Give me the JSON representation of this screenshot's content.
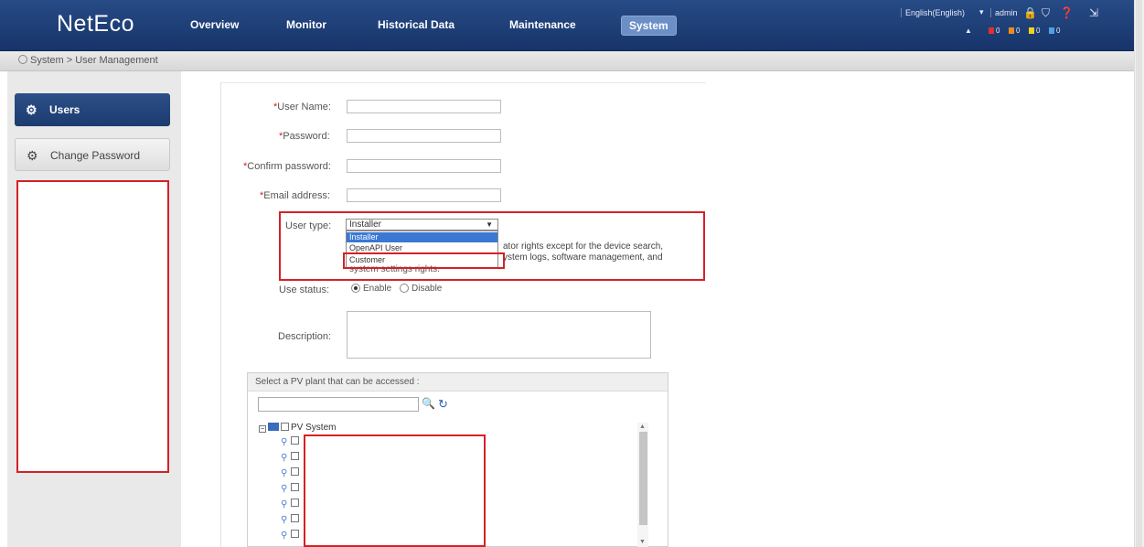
{
  "header": {
    "logo": "NetEco",
    "nav": [
      {
        "label": "Overview"
      },
      {
        "label": "Monitor"
      },
      {
        "label": "Historical Data"
      },
      {
        "label": "Maintenance"
      },
      {
        "label": "System"
      }
    ],
    "language": "English(English)",
    "language_caret": "▾",
    "user": "admin",
    "alarms": [
      "0",
      "0",
      "0",
      "0"
    ]
  },
  "breadcrumb": "System > User Management",
  "sidebar": {
    "items": [
      {
        "label": "Users"
      },
      {
        "label": "Change Password"
      }
    ]
  },
  "form": {
    "user_name_label": "User Name:",
    "password_label": "Password:",
    "confirm_password_label": "Confirm password:",
    "email_label": "Email address:",
    "user_type_label": "User type:",
    "user_type_value": "Installer",
    "user_type_options": [
      "Installer",
      "OpenAPI User",
      "Customer"
    ],
    "user_type_description": "ator rights except for the device search, ystem logs, software management, and",
    "user_type_description_tail": "system settings rights.",
    "use_status_label": "Use status:",
    "status_enable": "Enable",
    "status_disable": "Disable",
    "description_label": "Description:",
    "required_mark": "*",
    "user_name_value": "",
    "password_value": "",
    "confirm_password_value": "",
    "email_value": "",
    "description_value": ""
  },
  "plant_selector": {
    "title": "Select a PV plant that can be accessed :",
    "search_value": "",
    "tree_root": "PV System",
    "node_count": 7
  },
  "colors": {
    "header_bg": "#1f3f77",
    "accent": "#2c4f87",
    "annotation_red": "#d62027",
    "selected_option": "#3a78d4"
  }
}
